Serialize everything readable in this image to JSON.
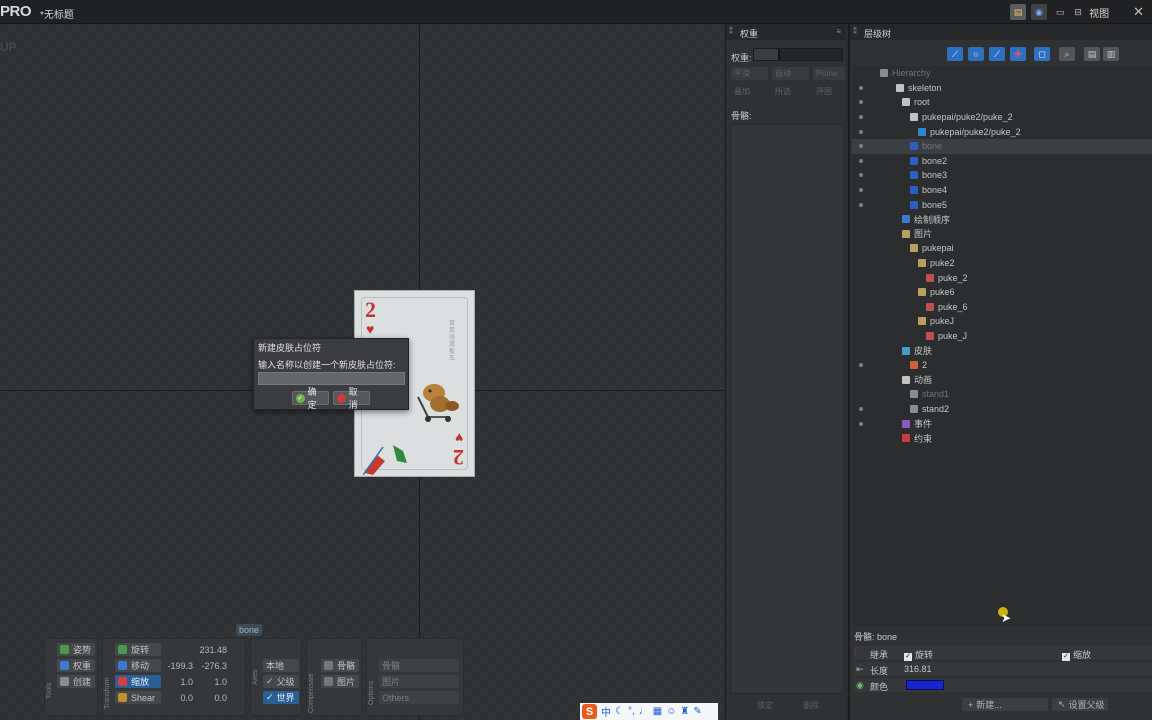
{
  "titlebar": {
    "logo": "PRO",
    "doc_title": "*无标题",
    "view_label": "视图",
    "close": "✕"
  },
  "viewport": {
    "corner_label": "UP",
    "card": {
      "rank": "2",
      "suit": "♥",
      "title_vertical": "鼠鼠骑滑板车"
    }
  },
  "dialog": {
    "title": "新建皮肤占位符",
    "prompt": "输入名称以创建一个新皮肤占位符:",
    "input_value": "",
    "ok_label": "确定",
    "cancel_label": "取消"
  },
  "bone_tag": "bone",
  "bottom_toolbar": {
    "tools": {
      "group_label": "Tools",
      "pose": "姿势",
      "weights": "权重",
      "create": "创建"
    },
    "transform": {
      "group_label": "Transform",
      "rotate": "旋转",
      "rotate_value": "231.48",
      "translate": "移动",
      "translate_x": "-199.3",
      "translate_y": "-276.3",
      "scale": "缩放",
      "scale_x": "1.0",
      "scale_y": "1.0",
      "shear": "Shear",
      "shear_x": "0.0",
      "shear_y": "0.0"
    },
    "axes": {
      "group_label": "Axes",
      "local": "本地",
      "parent": "父级",
      "world": "世界"
    },
    "compensate": {
      "group_label": "Compensate",
      "bones": "骨骼",
      "images": "图片"
    },
    "options": {
      "group_label": "Options",
      "row1": "骨骼",
      "row2": "图片",
      "row3": "Others"
    }
  },
  "weights_panel": {
    "title": "权重",
    "weight_label": "权重:",
    "buttons": [
      "平滑",
      "自动",
      "Prune"
    ],
    "toggles": [
      "叠加",
      "所选",
      "评图"
    ],
    "bones_label": "骨骼:",
    "footer_buttons": [
      "锁定",
      "删除"
    ]
  },
  "hierarchy_panel": {
    "title": "层级树",
    "tree": [
      {
        "label": "Hierarchy"
      },
      {
        "label": "skeleton"
      },
      {
        "label": "root"
      },
      {
        "label": "pukepai/puke2/puke_2"
      },
      {
        "label": "pukepai/puke2/puke_2"
      },
      {
        "label": "bone"
      },
      {
        "label": "bone2"
      },
      {
        "label": "bone3"
      },
      {
        "label": "bone4"
      },
      {
        "label": "bone5"
      },
      {
        "label": "绘制顺序"
      },
      {
        "label": "图片"
      },
      {
        "label": "pukepai"
      },
      {
        "label": "puke2"
      },
      {
        "label": "puke_2"
      },
      {
        "label": "puke6"
      },
      {
        "label": "puke_6"
      },
      {
        "label": "pukeJ"
      },
      {
        "label": "puke_J"
      },
      {
        "label": "皮肤"
      },
      {
        "label": "2"
      },
      {
        "label": "动画"
      },
      {
        "label": "stand1"
      },
      {
        "label": "stand2"
      },
      {
        "label": "事件"
      },
      {
        "label": "约束"
      }
    ],
    "properties": {
      "title": "骨骼: bone",
      "inherit_label": "继承",
      "inherit_rotate": "旋转",
      "inherit_scale": "缩放",
      "length_label": "长度",
      "length_value": "316.81",
      "color_label": "颜色",
      "color_hex": "#1626cc",
      "new_button": "新建...",
      "set_parent_button": "设置父级"
    }
  },
  "ime": {
    "brand": "S",
    "mode": "中"
  }
}
